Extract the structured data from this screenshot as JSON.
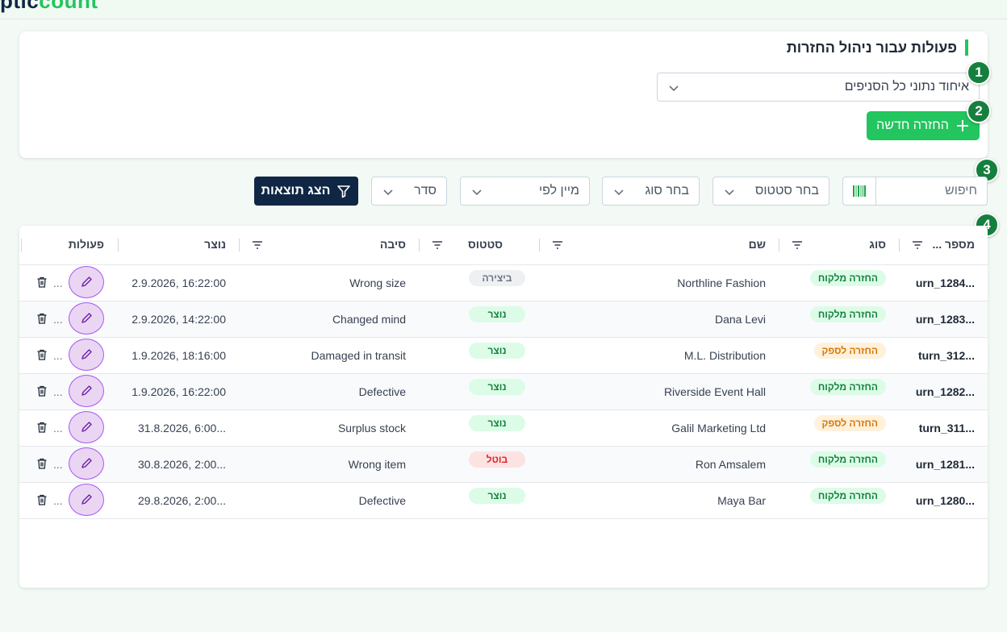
{
  "app": {
    "logo_part1": "ptic",
    "logo_part2": "count"
  },
  "actions_card": {
    "title": "פעולות עבור ניהול החזרות",
    "branch_select_value": "איחוד נתוני כל הסניפים",
    "new_return_label": "החזרה חדשה"
  },
  "tour_badges": [
    "1",
    "2",
    "3",
    "4"
  ],
  "filters": {
    "search_placeholder": "חיפוש",
    "status_placeholder": "בחר סטטוס",
    "type_placeholder": "בחר סוג",
    "sort_by_placeholder": "מיין לפי",
    "order_placeholder": "סדר",
    "show_results_label": "הצג תוצאות"
  },
  "table": {
    "headers": {
      "number": "מספר ...",
      "type": "סוג",
      "name": "שם",
      "status": "סטטוס",
      "reason": "סיבה",
      "created": "נוצר",
      "actions": "פעולות"
    },
    "rows": [
      {
        "number": "urn_1284...",
        "type": "החזרה מלקוח",
        "type_kind": "cust",
        "name": "Northline Fashion",
        "status": "ביצירה",
        "status_kind": "draft",
        "reason": "Wrong size",
        "created": "2.9.2026, 16:22:00",
        "more": "..."
      },
      {
        "number": "urn_1283...",
        "type": "החזרה מלקוח",
        "type_kind": "cust",
        "name": "Dana Levi",
        "status": "נוצר",
        "status_kind": "created",
        "reason": "Changed mind",
        "created": "2.9.2026, 14:22:00",
        "more": "..."
      },
      {
        "number": "turn_312...",
        "type": "החזרה לספק",
        "type_kind": "supp",
        "name": "M.L. Distribution",
        "status": "נוצר",
        "status_kind": "created",
        "reason": "Damaged in transit",
        "created": "1.9.2026, 18:16:00",
        "more": "..."
      },
      {
        "number": "urn_1282...",
        "type": "החזרה מלקוח",
        "type_kind": "cust",
        "name": "Riverside Event Hall",
        "status": "נוצר",
        "status_kind": "created",
        "reason": "Defective",
        "created": "1.9.2026, 16:22:00",
        "more": "..."
      },
      {
        "number": "turn_311...",
        "type": "החזרה לספק",
        "type_kind": "supp",
        "name": "Galil Marketing Ltd",
        "status": "נוצר",
        "status_kind": "created",
        "reason": "Surplus stock",
        "created": "31.8.2026, 6:00...",
        "more": "..."
      },
      {
        "number": "urn_1281...",
        "type": "החזרה מלקוח",
        "type_kind": "cust",
        "name": "Ron Amsalem",
        "status": "בוטל",
        "status_kind": "cancel",
        "reason": "Wrong item",
        "created": "30.8.2026, 2:00...",
        "more": "..."
      },
      {
        "number": "urn_1280...",
        "type": "החזרה מלקוח",
        "type_kind": "cust",
        "name": "Maya Bar",
        "status": "נוצר",
        "status_kind": "created",
        "reason": "Defective",
        "created": "29.8.2026, 2:00...",
        "more": "..."
      }
    ]
  },
  "icons": {
    "chevron": "chevron-down-icon",
    "plus": "plus-icon",
    "barcode": "barcode-icon",
    "filter": "filter-icon",
    "edit": "pencil-icon",
    "delete": "trash-icon"
  },
  "colors": {
    "brand_green": "#22c55e",
    "navy": "#0f2744",
    "edit_purple": "#a855f7",
    "cancel_red": "#dc2626",
    "supplier_orange": "#d97706"
  }
}
